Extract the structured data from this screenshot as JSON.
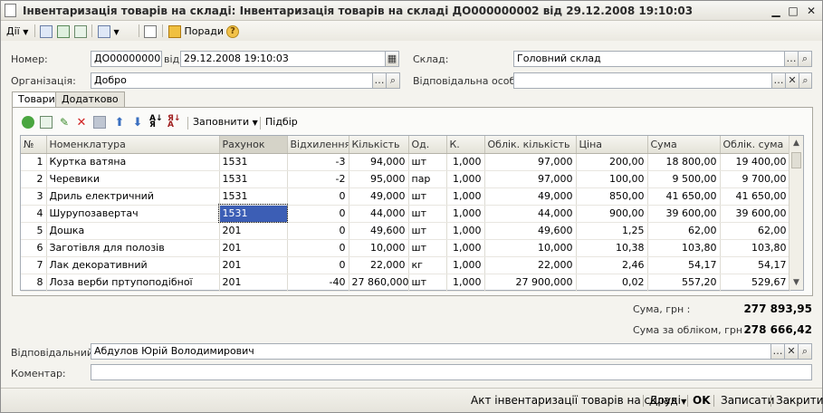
{
  "window": {
    "title": "Інвентаризація товарів на складі: Інвентаризація товарів на складі ДО000000002 від 29.12.2008 19:10:03"
  },
  "toolbar": {
    "actions_label": "Дії",
    "tips_label": "Поради"
  },
  "form": {
    "number_label": "Номер:",
    "number": "ДО000000002",
    "date_label": "від:",
    "date": "29.12.2008 19:10:03",
    "org_label": "Організація:",
    "org": "Добро",
    "warehouse_label": "Склад:",
    "warehouse": "Головний склад",
    "resp_person_label": "Відповідальна особа:",
    "resp_person": ""
  },
  "tabs": [
    "Товари",
    "Додатково"
  ],
  "grid_toolbar": {
    "fill_label": "Заповнити",
    "select_label": "Підбір"
  },
  "table": {
    "columns": [
      "№",
      "Номенклатура",
      "Рахунок",
      "Відхилення",
      "Кількість",
      "Од.",
      "К.",
      "Облік. кількість",
      "Ціна",
      "Сума",
      "Облік. сума"
    ],
    "rows": [
      [
        "1",
        "Куртка ватяна",
        "1531",
        "-3",
        "94,000",
        "шт",
        "1,000",
        "97,000",
        "200,00",
        "18 800,00",
        "19 400,00"
      ],
      [
        "2",
        "Черевики",
        "1531",
        "-2",
        "95,000",
        "пар",
        "1,000",
        "97,000",
        "100,00",
        "9 500,00",
        "9 700,00"
      ],
      [
        "3",
        "Дриль електричний",
        "1531",
        "0",
        "49,000",
        "шт",
        "1,000",
        "49,000",
        "850,00",
        "41 650,00",
        "41 650,00"
      ],
      [
        "4",
        "Шурупозавертач",
        "1531",
        "0",
        "44,000",
        "шт",
        "1,000",
        "44,000",
        "900,00",
        "39 600,00",
        "39 600,00"
      ],
      [
        "5",
        "Дошка",
        "201",
        "0",
        "49,600",
        "шт",
        "1,000",
        "49,600",
        "1,25",
        "62,00",
        "62,00"
      ],
      [
        "6",
        "Заготівля для полозів",
        "201",
        "0",
        "10,000",
        "шт",
        "1,000",
        "10,000",
        "10,38",
        "103,80",
        "103,80"
      ],
      [
        "7",
        "Лак декоративний",
        "201",
        "0",
        "22,000",
        "кг",
        "1,000",
        "22,000",
        "2,46",
        "54,17",
        "54,17"
      ],
      [
        "8",
        "Лоза верби пртупоподібної",
        "201",
        "-40",
        "27 860,000",
        "шт",
        "1,000",
        "27 900,000",
        "0,02",
        "557,20",
        "529,67"
      ]
    ]
  },
  "totals": {
    "sum_label": "Сума, грн :",
    "sum": "277 893,95",
    "acc_sum_label": "Сума за обліком, грн :",
    "acc_sum": "278 666,42"
  },
  "bottom": {
    "responsible_label": "Відповідальний:",
    "responsible": "Абдулов Юрій Володимирович",
    "comment_label": "Коментар:",
    "comment": ""
  },
  "footer": {
    "print_act": "Акт інвентаризації товарів на складі",
    "print": "Друк",
    "ok": "OK",
    "save": "Записати",
    "close": "Закрити"
  }
}
